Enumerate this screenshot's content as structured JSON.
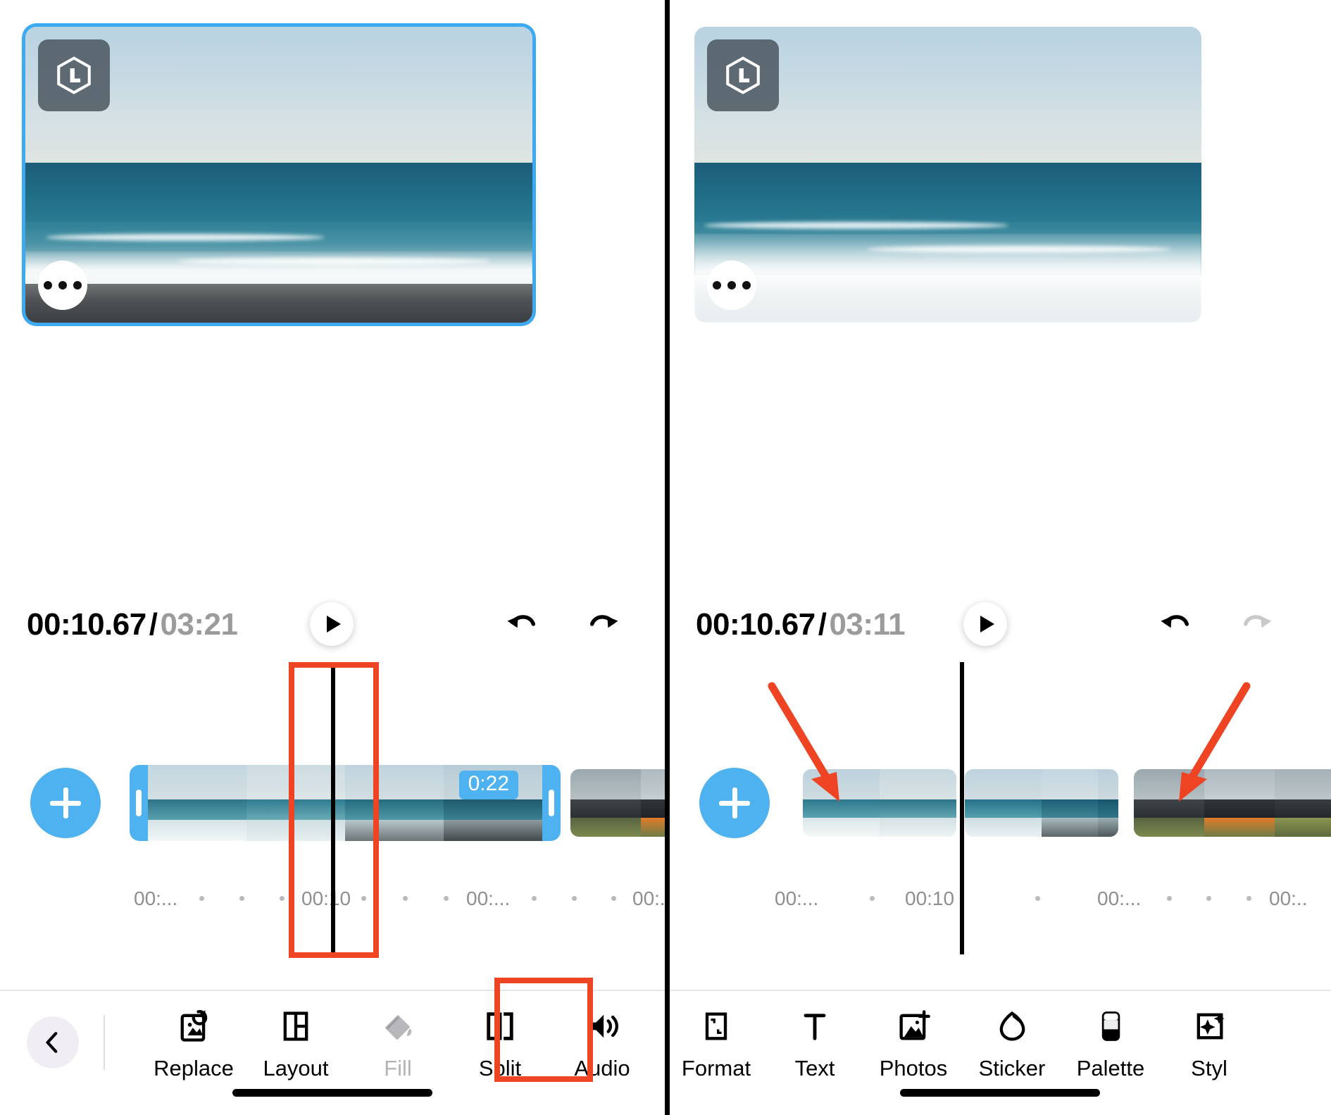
{
  "app": {
    "accent_blue": "#4db2ef",
    "annotation_red": "#ef4423",
    "logo_letter": "L"
  },
  "panels": [
    {
      "id": "before",
      "preview": {
        "selected": true,
        "logo_badge_name": "hexagon-L-logo",
        "more_button_label": "•••"
      },
      "transport": {
        "current_time": "00:10.67",
        "separator": "/",
        "total_time": "03:21",
        "play_label": "Play",
        "undo_label": "Undo",
        "undo_enabled": true,
        "redo_label": "Redo",
        "redo_enabled": true
      },
      "timeline": {
        "add_button_label": "+",
        "selected_clip_duration": "0:22",
        "ruler_labels": [
          "00:...",
          "00:10",
          "00:...",
          "00:.."
        ]
      },
      "toolbar": {
        "back_label": "Back",
        "items": [
          {
            "label": "Replace",
            "icon": "replace-photo-icon",
            "enabled": true
          },
          {
            "label": "Layout",
            "icon": "layout-grid-icon",
            "enabled": true
          },
          {
            "label": "Fill",
            "icon": "paint-bucket-icon",
            "enabled": false
          },
          {
            "label": "Split",
            "icon": "split-brackets-icon",
            "enabled": true,
            "highlighted": true
          },
          {
            "label": "Audio",
            "icon": "speaker-volume-icon",
            "enabled": true,
            "clipped": true
          }
        ]
      }
    },
    {
      "id": "after",
      "preview": {
        "selected": false,
        "logo_badge_name": "hexagon-L-logo",
        "more_button_label": "•••"
      },
      "transport": {
        "current_time": "00:10.67",
        "separator": "/",
        "total_time": "03:11",
        "play_label": "Play",
        "undo_label": "Undo",
        "undo_enabled": true,
        "redo_label": "Redo",
        "redo_enabled": false
      },
      "timeline": {
        "add_button_label": "+",
        "ruler_labels": [
          "00:...",
          "00:10",
          "00:...",
          "00:.."
        ]
      },
      "toolbar": {
        "items": [
          {
            "label": "Format",
            "icon": "format-frame-icon",
            "enabled": true
          },
          {
            "label": "Text",
            "icon": "text-T-icon",
            "enabled": true
          },
          {
            "label": "Photos",
            "icon": "photo-add-icon",
            "enabled": true
          },
          {
            "label": "Sticker",
            "icon": "sticker-peel-icon",
            "enabled": true
          },
          {
            "label": "Palette",
            "icon": "palette-swatch-icon",
            "enabled": true
          },
          {
            "label": "Styl",
            "icon": "style-sparkle-icon",
            "enabled": true,
            "clipped": true
          }
        ]
      }
    }
  ],
  "annotations": {
    "split_tool_box_label": "Split tool highlight",
    "playhead_box_label": "Playhead highlight",
    "arrow_left_label": "points to first split clip",
    "arrow_right_label": "points to second split clip"
  }
}
